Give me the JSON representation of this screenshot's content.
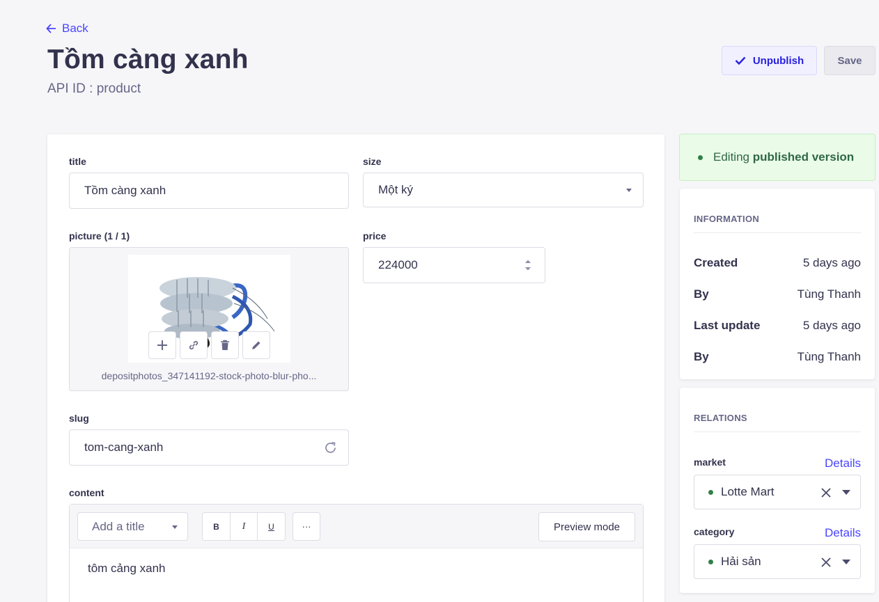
{
  "header": {
    "back_label": "Back",
    "title": "Tồm càng xanh",
    "api_id": "API ID : product",
    "unpublish_label": "Unpublish",
    "save_label": "Save"
  },
  "form": {
    "title": {
      "label": "title",
      "value": "Tồm càng xanh"
    },
    "size": {
      "label": "size",
      "value": "Một ký"
    },
    "picture": {
      "label": "picture (1 / 1)",
      "filename": "depositphotos_347141192-stock-photo-blur-pho..."
    },
    "price": {
      "label": "price",
      "value": "224000"
    },
    "slug": {
      "label": "slug",
      "value": "tom-cang-xanh"
    },
    "content": {
      "label": "content",
      "heading_select": "Add a title",
      "bold": "B",
      "italic": "I",
      "underline": "U",
      "more": "···",
      "preview_label": "Preview mode",
      "body": "tôm cảng xanh"
    }
  },
  "sidebar": {
    "status_prefix": "Editing",
    "status_strong": "published version",
    "information": {
      "heading": "INFORMATION",
      "rows": [
        {
          "key": "Created",
          "value": "5 days ago"
        },
        {
          "key": "By",
          "value": "Tùng Thanh"
        },
        {
          "key": "Last update",
          "value": "5 days ago"
        },
        {
          "key": "By",
          "value": "Tùng Thanh"
        }
      ]
    },
    "relations": {
      "heading": "RELATIONS",
      "market": {
        "label": "market",
        "details": "Details",
        "value": "Lotte Mart"
      },
      "category": {
        "label": "category",
        "details": "Details",
        "value": "Hải sản"
      }
    }
  },
  "colors": {
    "primary": "#4945ff",
    "background": "#f6f6f9",
    "success": "#328048",
    "text": "#32324d",
    "muted": "#666687"
  }
}
